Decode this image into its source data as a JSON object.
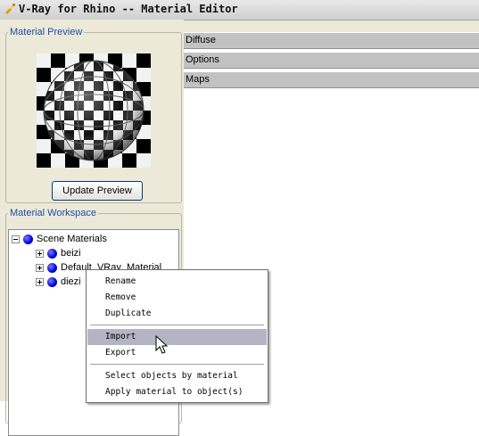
{
  "window": {
    "title": "V-Ray for Rhino -- Material Editor"
  },
  "preview": {
    "group_label": "Material Preview",
    "update_button": "Update Preview"
  },
  "workspace": {
    "group_label": "Material Workspace",
    "tree": {
      "root": "Scene Materials",
      "children": [
        "beizi",
        "Default_VRay_Material",
        "diezi"
      ]
    }
  },
  "sections": [
    "Diffuse",
    "Options",
    "Maps"
  ],
  "context_menu": {
    "rename": "Rename",
    "remove": "Remove",
    "duplicate": "Duplicate",
    "import": "Import",
    "export": "Export",
    "select_objects": "Select objects by material",
    "apply_material": "Apply material to object(s)"
  },
  "colors": {
    "node_dot": "#0000d8",
    "menu_highlight": "#b4b4c4",
    "group_label": "#1c4fa6"
  }
}
